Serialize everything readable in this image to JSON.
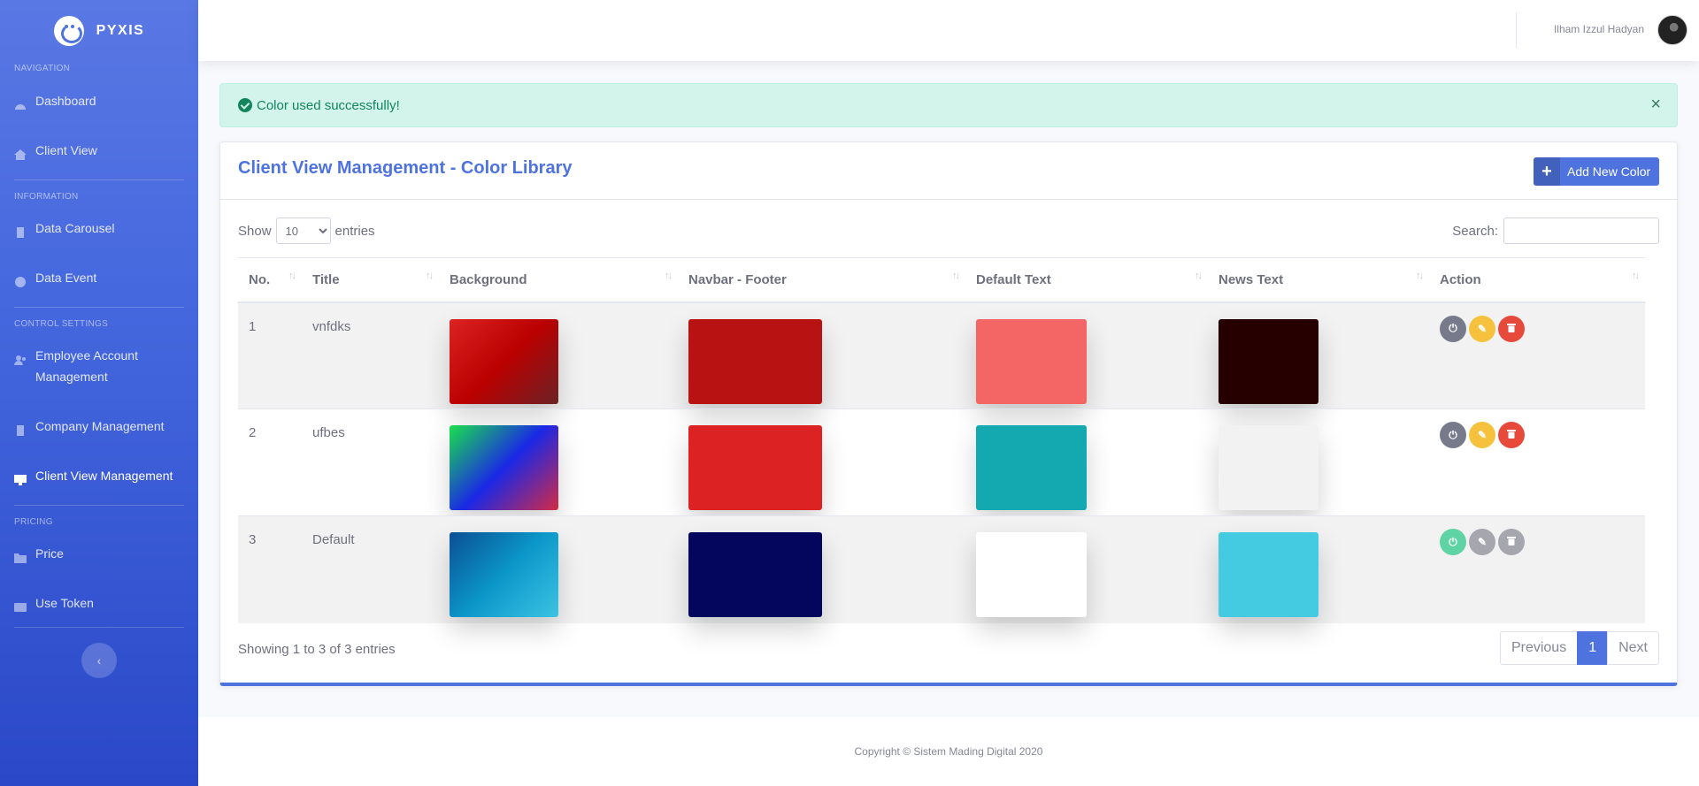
{
  "brand": {
    "name": "PYXIS"
  },
  "sidebar": {
    "sections": [
      {
        "heading": "NAVIGATION"
      },
      {
        "heading": "INFORMATION"
      },
      {
        "heading": "CONTROL SETTINGS"
      },
      {
        "heading": "PRICING"
      }
    ],
    "items": [
      {
        "label": "Dashboard",
        "icon": "dashboard-icon"
      },
      {
        "label": "Client View",
        "icon": "home-icon"
      },
      {
        "label": "Data Carousel",
        "icon": "file-icon"
      },
      {
        "label": "Data Event",
        "icon": "info-icon"
      },
      {
        "label": "Employee Account Management",
        "icon": "users-icon"
      },
      {
        "label": "Company Management",
        "icon": "building-icon"
      },
      {
        "label": "Client View Management",
        "icon": "desktop-icon",
        "active": true
      },
      {
        "label": "Price",
        "icon": "folder-icon"
      },
      {
        "label": "Use Token",
        "icon": "card-icon"
      }
    ],
    "collapse_glyph": "‹"
  },
  "topbar": {
    "user_name": "Ilham Izzul Hadyan"
  },
  "alert": {
    "message": "Color used successfully!",
    "close": "×"
  },
  "card": {
    "title": "Client View Management - Color Library",
    "add_button": "Add New Color",
    "show_label": "Show",
    "entries_label": "entries",
    "page_length": "10",
    "search_label": "Search:"
  },
  "table": {
    "columns": [
      "No.",
      "Title",
      "Background",
      "Navbar - Footer",
      "Default Text",
      "News Text",
      "Action"
    ],
    "rows": [
      {
        "no": "1",
        "title": "vnfdks",
        "background": [
          "#dd2222",
          "#bb0000",
          "#6b2226"
        ],
        "navbar": "#b81212",
        "text": "#f46666",
        "news": "#260000",
        "actions": [
          "#777a8a",
          "#f6c23e",
          "#e74a3b"
        ]
      },
      {
        "no": "2",
        "title": "ufbes",
        "background": [
          "#19e04c",
          "#1a28e6",
          "#d32b44"
        ],
        "navbar": "#dc2222",
        "text": "#14a8b1",
        "news": "#f2f2f2",
        "actions": [
          "#777a8a",
          "#f6c23e",
          "#e74a3b"
        ]
      },
      {
        "no": "3",
        "title": "Default",
        "background": [
          "#0b4f94",
          "#0b97c9",
          "#3cc3e3"
        ],
        "navbar": "#04065e",
        "text": "#ffffff",
        "news": "#44cbe2",
        "actions": [
          "#5ed4a4",
          "#a5a6ae",
          "#a5a6ae"
        ]
      }
    ]
  },
  "pagination": {
    "info": "Showing 1 to 3 of 3 entries",
    "prev": "Previous",
    "current": "1",
    "next": "Next"
  },
  "footer": {
    "text": "Copyright © Sistem Mading Digital 2020"
  },
  "colors": {
    "primary": "#4e73df",
    "success": "#1cc88a",
    "warning": "#f6c23e",
    "danger": "#e74a3b"
  }
}
